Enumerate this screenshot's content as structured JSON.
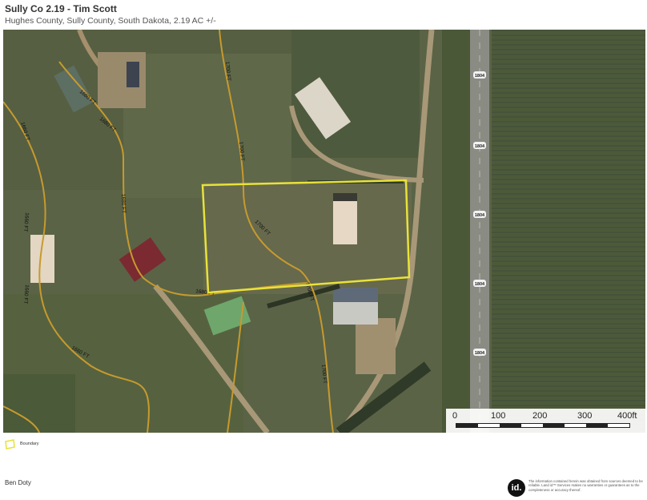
{
  "header": {
    "title": "Sully Co 2.19 - Tim Scott",
    "subtitle": "Hughes County, Sully County, South Dakota, 2.19 AC +/-"
  },
  "map": {
    "basemap": "satellite imagery",
    "contour_labels": [
      "1680 FT",
      "1680 FT",
      "1700 FT",
      "1700 FT",
      "1660 FT",
      "1680 FT",
      "1660 FT",
      "1700 FT",
      "1700 FT",
      "1660 FT",
      "1680 FT",
      "1660 FT",
      "1700 FT"
    ],
    "road_shields": [
      "1804",
      "1804",
      "1804",
      "1804",
      "1804"
    ],
    "boundary_color": "#e8e23a",
    "contour_color": "#c79a2e"
  },
  "scalebar": {
    "ticks": [
      "0",
      "100",
      "200",
      "300",
      "400ft"
    ]
  },
  "legend": {
    "items": [
      {
        "label": "Boundary",
        "color": "#e8e23a"
      }
    ]
  },
  "footer": {
    "agent": "Ben Doty",
    "logo_text": "id.",
    "disclaimer": "The information contained herein was obtained from sources deemed to be reliable. Land id™ Services makes no warranties or guarantees as to the completeness or accuracy thereof."
  }
}
